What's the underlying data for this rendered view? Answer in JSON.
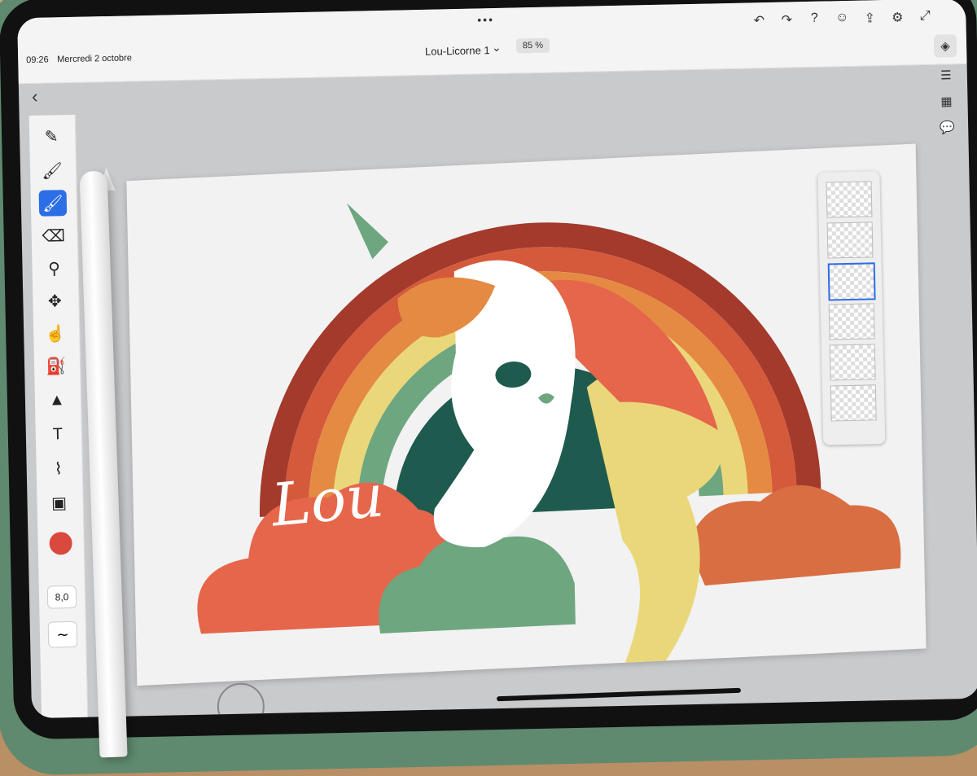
{
  "status": {
    "time": "09:26",
    "date": "Mercredi 2 octobre"
  },
  "header": {
    "dots": "•••",
    "doc_title": "Lou-Licorne 1",
    "chevron": "⌄",
    "zoom": "85 %",
    "back": "‹",
    "actions": [
      "↶",
      "↷",
      "?",
      "☺",
      "⇪",
      "⚙",
      "⤢"
    ]
  },
  "left_toolbar": {
    "tools": [
      {
        "name": "brush-tool",
        "glyph": "✎"
      },
      {
        "name": "paint-brush-tool",
        "glyph": "🖌"
      },
      {
        "name": "active-brush-tool",
        "glyph": "🖌",
        "active": true
      },
      {
        "name": "eraser-tool",
        "glyph": "⌫"
      },
      {
        "name": "lasso-tool",
        "glyph": "⚲"
      },
      {
        "name": "move-tool",
        "glyph": "✥"
      },
      {
        "name": "smudge-tool",
        "glyph": "☝"
      },
      {
        "name": "fill-tool",
        "glyph": "⛽"
      },
      {
        "name": "shape-tool",
        "glyph": "▲"
      },
      {
        "name": "text-tool",
        "glyph": "T"
      },
      {
        "name": "eyedropper-tool",
        "glyph": "⌇"
      },
      {
        "name": "image-tool",
        "glyph": "▣"
      }
    ],
    "color": "#d9493d",
    "size_value": "8,0",
    "smoothing_glyph": "∼"
  },
  "right_toolbar": {
    "tools": [
      {
        "name": "layers-icon",
        "glyph": "◈",
        "active": true
      },
      {
        "name": "adjustments-icon",
        "glyph": "☰"
      },
      {
        "name": "grid-icon",
        "glyph": "▦"
      },
      {
        "name": "comment-icon",
        "glyph": "💬"
      }
    ]
  },
  "canvas": {
    "lettering": "Lou"
  },
  "colors": {
    "active_tool": "#2b6ee6",
    "rainbow": [
      "#a33a2c",
      "#d45a3b",
      "#e58a43",
      "#ead77a",
      "#6ea67f",
      "#1f5a4f"
    ],
    "cloud_red": "#e6664b",
    "cloud_green": "#6ea67f",
    "cloud_orange": "#d96e43"
  }
}
